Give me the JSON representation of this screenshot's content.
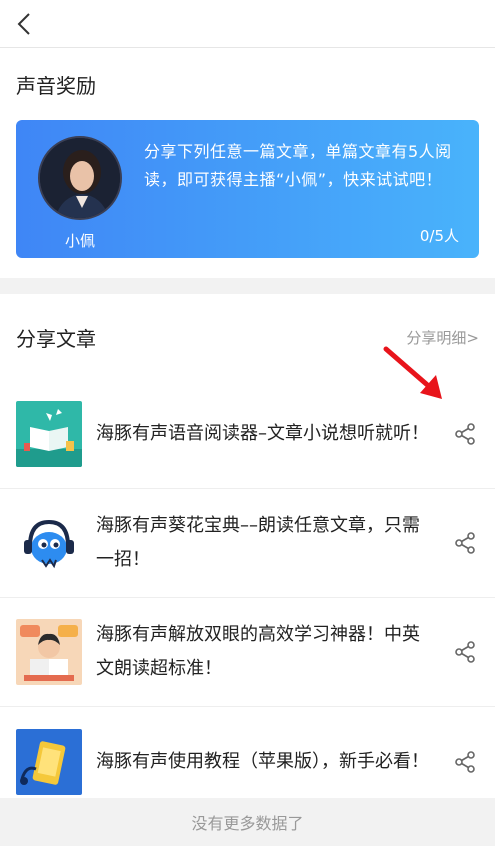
{
  "header": {
    "back_icon": "chevron-left-icon"
  },
  "reward": {
    "title": "声音奖励",
    "avatar_name": "小佩",
    "description": "分享下列任意一篇文章，单篇文章有5人阅读，即可获得主播“小佩”，快来试试吧！",
    "progress": "0/5人",
    "gradient_start": "#3f86f6",
    "gradient_end": "#49b3fb"
  },
  "share": {
    "title": "分享文章",
    "detail_link": "分享明细>",
    "articles": [
      {
        "title": "海豚有声语音阅读器–文章小说想听就听！",
        "thumb": "book-illustration"
      },
      {
        "title": "海豚有声葵花宝典––朗读任意文章，只需一招！",
        "thumb": "dolphin-headphones"
      },
      {
        "title": "海豚有声解放双眼的高效学习神器！中英文朗读超标准！",
        "thumb": "child-reading"
      },
      {
        "title": "海豚有声使用教程（苹果版），新手必看！",
        "thumb": "phone-headphones"
      }
    ]
  },
  "footer": {
    "no_more": "没有更多数据了"
  },
  "annotation": {
    "arrow_color": "#e8141b"
  }
}
